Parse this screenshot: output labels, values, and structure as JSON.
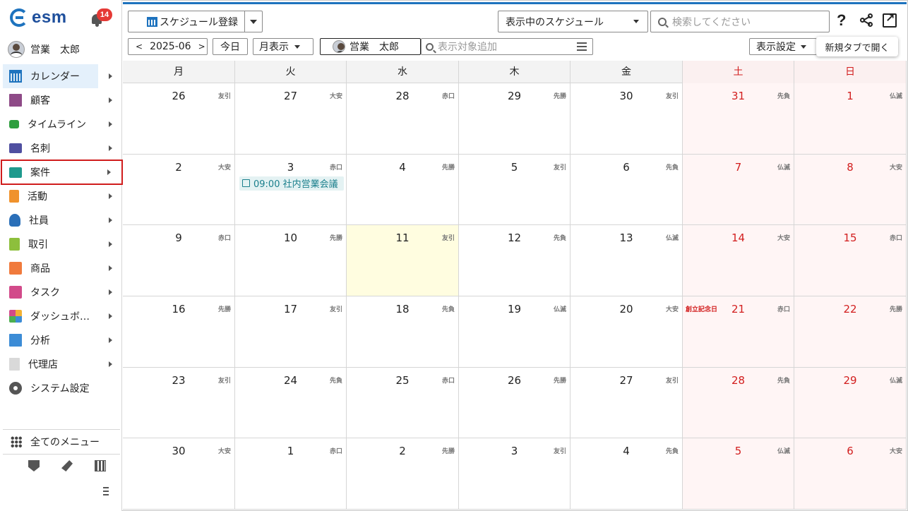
{
  "app": {
    "logo_text": "esm",
    "notification_count": "14",
    "user_name": "営業　太郎"
  },
  "sidebar": {
    "items": [
      {
        "label": "カレンダー",
        "icon": "calendar-icon",
        "active": true
      },
      {
        "label": "顧客",
        "icon": "building-icon"
      },
      {
        "label": "タイムライン",
        "icon": "timeline-chat-icon"
      },
      {
        "label": "名刺",
        "icon": "business-card-icon"
      },
      {
        "label": "案件",
        "icon": "folder-icon",
        "highlighted": true
      },
      {
        "label": "活動",
        "icon": "clipboard-icon"
      },
      {
        "label": "社員",
        "icon": "employee-icon"
      },
      {
        "label": "取引",
        "icon": "deal-icon"
      },
      {
        "label": "商品",
        "icon": "product-box-icon"
      },
      {
        "label": "タスク",
        "icon": "task-check-icon"
      },
      {
        "label": "ダッシュボ…",
        "icon": "dashboard-icon"
      },
      {
        "label": "分析",
        "icon": "analytics-chart-icon"
      },
      {
        "label": "代理店",
        "icon": "agency-document-icon"
      },
      {
        "label": "システム設定",
        "icon": "gear-icon"
      }
    ],
    "all_menu": "全てのメニュー"
  },
  "toolbar": {
    "register_label": "スケジュール登録",
    "view_select": "表示中のスケジュール",
    "search_placeholder": "検索してください",
    "month_label": "2025-06",
    "today_label": "今日",
    "view_mode": "月表示",
    "filter_user": "営業　太郎",
    "add_target_placeholder": "表示対象追加",
    "display_settings": "表示設定",
    "tooltip": "新規タブで開く",
    "help": "?"
  },
  "calendar": {
    "weekdays": [
      "月",
      "火",
      "水",
      "木",
      "金",
      "土",
      "日"
    ],
    "weeks": [
      [
        {
          "d": "26",
          "r": "友引"
        },
        {
          "d": "27",
          "r": "大安"
        },
        {
          "d": "28",
          "r": "赤口"
        },
        {
          "d": "29",
          "r": "先勝"
        },
        {
          "d": "30",
          "r": "友引"
        },
        {
          "d": "31",
          "r": "先負"
        },
        {
          "d": "1",
          "r": "仏滅"
        }
      ],
      [
        {
          "d": "2",
          "r": "大安"
        },
        {
          "d": "3",
          "r": "赤口",
          "event": "09:00 社内営業会議"
        },
        {
          "d": "4",
          "r": "先勝"
        },
        {
          "d": "5",
          "r": "友引"
        },
        {
          "d": "6",
          "r": "先負"
        },
        {
          "d": "7",
          "r": "仏滅"
        },
        {
          "d": "8",
          "r": "大安"
        }
      ],
      [
        {
          "d": "9",
          "r": "赤口"
        },
        {
          "d": "10",
          "r": "先勝"
        },
        {
          "d": "11",
          "r": "友引",
          "today": true
        },
        {
          "d": "12",
          "r": "先負"
        },
        {
          "d": "13",
          "r": "仏滅"
        },
        {
          "d": "14",
          "r": "大安"
        },
        {
          "d": "15",
          "r": "赤口"
        }
      ],
      [
        {
          "d": "16",
          "r": "先勝"
        },
        {
          "d": "17",
          "r": "友引"
        },
        {
          "d": "18",
          "r": "先負"
        },
        {
          "d": "19",
          "r": "仏滅"
        },
        {
          "d": "20",
          "r": "大安"
        },
        {
          "d": "21",
          "r": "赤口",
          "holiday": "創立記念日"
        },
        {
          "d": "22",
          "r": "先勝"
        }
      ],
      [
        {
          "d": "23",
          "r": "友引"
        },
        {
          "d": "24",
          "r": "先負"
        },
        {
          "d": "25",
          "r": "赤口"
        },
        {
          "d": "26",
          "r": "先勝"
        },
        {
          "d": "27",
          "r": "友引"
        },
        {
          "d": "28",
          "r": "先負"
        },
        {
          "d": "29",
          "r": "仏滅"
        }
      ],
      [
        {
          "d": "30",
          "r": "大安"
        },
        {
          "d": "1",
          "r": "赤口"
        },
        {
          "d": "2",
          "r": "先勝"
        },
        {
          "d": "3",
          "r": "友引"
        },
        {
          "d": "4",
          "r": "先負"
        },
        {
          "d": "5",
          "r": "仏滅"
        },
        {
          "d": "6",
          "r": "大安"
        }
      ]
    ]
  },
  "colors": {
    "accent": "#1e73be",
    "weekend_red": "#d21e1e",
    "highlight_border": "#d01c1c",
    "today_bg": "#fffde0",
    "event_teal": "#1a7f8c"
  }
}
